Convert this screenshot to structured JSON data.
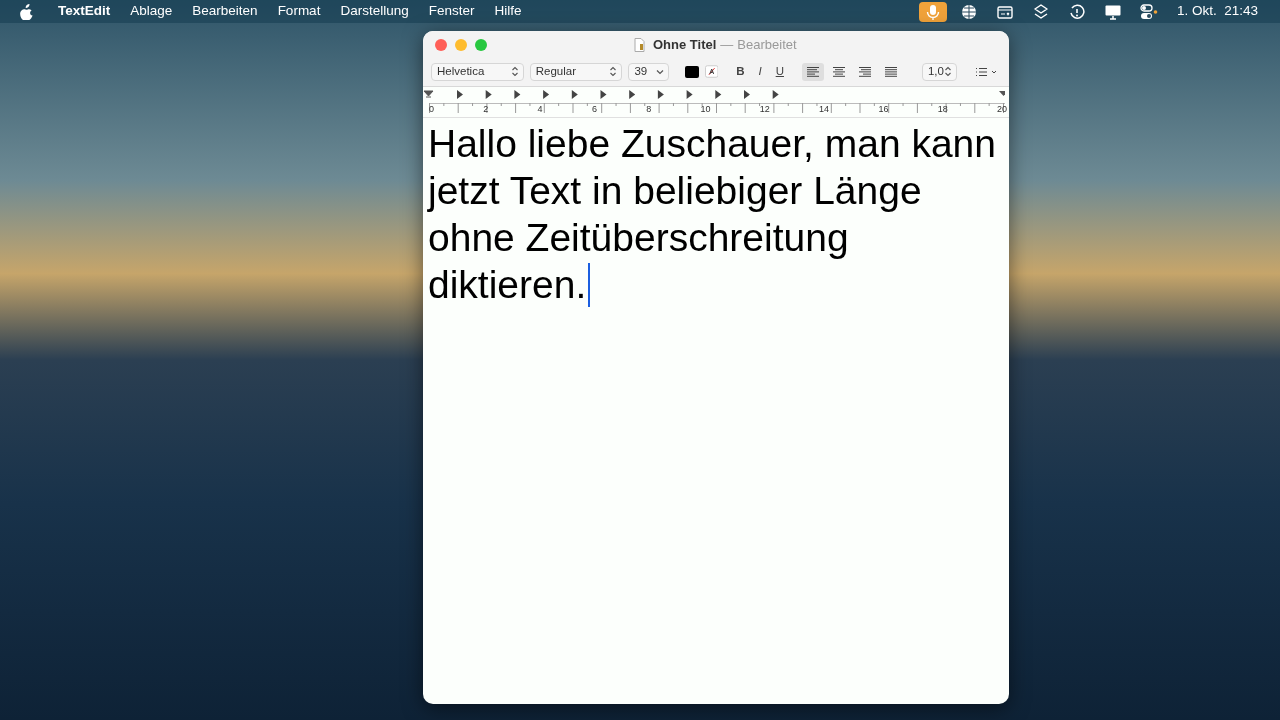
{
  "menu_bar": {
    "items": [
      {
        "label": "TextEdit",
        "kind": "app"
      },
      {
        "label": "Ablage",
        "kind": "menu"
      },
      {
        "label": "Bearbeiten",
        "kind": "menu"
      },
      {
        "label": "Format",
        "kind": "menu"
      },
      {
        "label": "Darstellung",
        "kind": "menu"
      },
      {
        "label": "Fenster",
        "kind": "menu"
      },
      {
        "label": "Hilfe",
        "kind": "menu"
      }
    ],
    "status_icons": [
      {
        "kind": "microphone",
        "active": true
      },
      {
        "kind": "globe",
        "active": false
      },
      {
        "kind": "window",
        "active": false
      },
      {
        "kind": "layers",
        "active": false
      },
      {
        "kind": "clock",
        "active": false
      },
      {
        "kind": "display",
        "active": false
      },
      {
        "kind": "controls",
        "active": false
      }
    ],
    "clock": "1. Okt.  21:43"
  },
  "window": {
    "title": "Ohne Titel",
    "separator": "—",
    "subtitle": "Bearbeitet",
    "toolbar": {
      "font": "Helvetica",
      "style": "Regular",
      "size": "39",
      "bold": "B",
      "italic": "I",
      "underline": "U",
      "alignments": [
        {
          "kind": "left",
          "selected": true
        },
        {
          "kind": "center",
          "selected": false
        },
        {
          "kind": "right",
          "selected": false
        },
        {
          "kind": "justify",
          "selected": false
        }
      ],
      "line_spacing": "1,0"
    },
    "ruler": [
      "0",
      "2",
      "4",
      "6",
      "8",
      "10",
      "12",
      "14",
      "16",
      "18",
      "20"
    ],
    "document_lines": [
      "Hallo liebe Zuschauer, man kann",
      "jetzt Text in beliebiger Länge",
      "ohne Zeitüberschreitung",
      "diktieren."
    ]
  }
}
